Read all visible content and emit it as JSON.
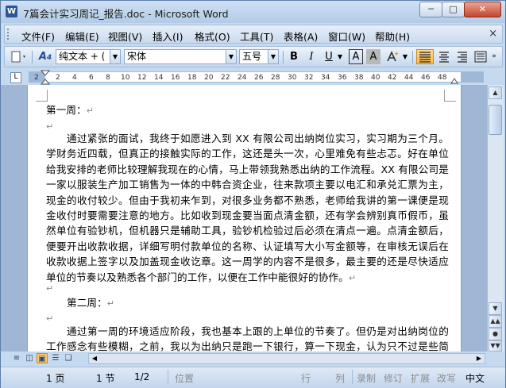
{
  "window": {
    "title": "7篇会计实习周记_报告.doc - Microsoft Word",
    "app_icon": "W",
    "controls": {
      "minimize": "─",
      "maximize": "□",
      "close": "✕"
    }
  },
  "menubar": {
    "items": [
      "文件(F)",
      "编辑(E)",
      "视图(V)",
      "插入(I)",
      "格式(O)",
      "工具(T)",
      "表格(A)",
      "窗口(W)",
      "帮助(H)"
    ],
    "close_doc": "×"
  },
  "toolbar": {
    "style_value": "纯文本 + (",
    "font_value": "宋体",
    "size_value": "五号",
    "bold": "B",
    "italic": "I",
    "underline": "U",
    "char_border": "A",
    "char_shading": "A"
  },
  "ruler": {
    "labels": [
      "2",
      "2",
      "4",
      "6",
      "8",
      "10",
      "12",
      "14",
      "16",
      "18",
      "20",
      "22",
      "24",
      "26",
      "28",
      "30",
      "32",
      "34",
      "36",
      "38",
      "40",
      "42",
      "44",
      "46",
      "48"
    ]
  },
  "document": {
    "heading1": "第一周：",
    "paragraph1": "通过紧张的面试，我终于如愿进入到 XX 有限公司出纳岗位实习，实习期为三个月。学财务近四载，但真正的接触实际的工作，这还是头一次，心里难免有些忐忑。好在单位给我安排的老师比较理解我现在的心情，马上带领我熟悉出纳的工作流程。XX 有限公司是一家以服装生产加工销售为一体的中韩合资企业，往来款项主要以电汇和承兑汇票为主，现金的收付较少。但由于我初来乍到，对很多业务都不熟悉，老师给我讲的第一课便是现金收付时要需要注意的地方。比如收到现金要当面点清金额，还有学会辨别真币假币，虽然单位有验钞机，但机器只是辅助工具，验钞机检验过后必须在清点一遍。点清金额后，便要开出收款收据，详细写明付款单位的名称、认证填写大小写金额等，在审核无误后在收款收据上签字以及加盖现金收讫章。这一周学的内容不是很多，最主要的还是尽快适应单位的节奏以及熟悉各个部门的工作，以便在工作中能很好的协作。",
    "heading2": "第二周：",
    "paragraph2": "通过第一周的环境适应阶段，我也基本上跟的上单位的节奏了。但仍是对出纳岗位的工作感念有些模糊，之前，我以为出纳只是跑一下银行，算一下现金，认为只不过是些简单而",
    "return_mark": "↵"
  },
  "statusbar": {
    "page": "1 页",
    "section": "1 节",
    "page_of": "1/2",
    "position": "位置",
    "line": "行",
    "column": "列",
    "rec": "录制",
    "trk": "修订",
    "ext": "扩展",
    "ovr": "改写",
    "language": "中文"
  },
  "colors": {
    "frame": "#c6daef",
    "active_button": "#ffb943",
    "page": "#ffffff",
    "workspace": "#9fb6d4"
  }
}
